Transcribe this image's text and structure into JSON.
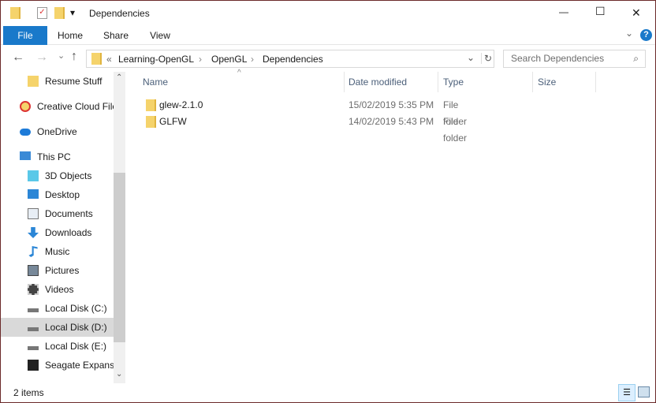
{
  "window": {
    "title": "Dependencies",
    "minimize": "—",
    "maximize": "☐",
    "close": "✕"
  },
  "ribbon": {
    "tabs": [
      "File",
      "Home",
      "Share",
      "View"
    ],
    "expand": "⌄",
    "help": "?"
  },
  "nav": {
    "back": "←",
    "forward": "→",
    "recent": "⌄",
    "up": "↑",
    "breadcrumb": [
      "«",
      "Learning-OpenGL",
      "OpenGL",
      "Dependencies"
    ],
    "sep": "›",
    "dropdown": "⌄",
    "refresh": "↻",
    "search_placeholder": "Search Dependencies"
  },
  "sidebar": {
    "items": [
      {
        "label": "Resume Stuff",
        "icon": "folder-icon"
      },
      {
        "label": "Creative Cloud Files",
        "icon": "creative-cloud-icon"
      },
      {
        "label": "OneDrive",
        "icon": "onedrive-icon"
      },
      {
        "label": "This PC",
        "icon": "pc-icon"
      },
      {
        "label": "3D Objects",
        "icon": "3d-objects-icon"
      },
      {
        "label": "Desktop",
        "icon": "desktop-icon"
      },
      {
        "label": "Documents",
        "icon": "documents-icon"
      },
      {
        "label": "Downloads",
        "icon": "downloads-icon"
      },
      {
        "label": "Music",
        "icon": "music-icon"
      },
      {
        "label": "Pictures",
        "icon": "pictures-icon"
      },
      {
        "label": "Videos",
        "icon": "videos-icon"
      },
      {
        "label": "Local Disk (C:)",
        "icon": "disk-icon"
      },
      {
        "label": "Local Disk (D:)",
        "icon": "disk-icon",
        "selected": true
      },
      {
        "label": "Local Disk (E:)",
        "icon": "disk-icon"
      },
      {
        "label": "Seagate Expansion Drive",
        "icon": "external-drive-icon"
      }
    ]
  },
  "columns": [
    "Name",
    "Date modified",
    "Type",
    "Size"
  ],
  "files": [
    {
      "name": "glew-2.1.0",
      "date": "15/02/2019 5:35 PM",
      "type": "File folder",
      "size": ""
    },
    {
      "name": "GLFW",
      "date": "14/02/2019 5:43 PM",
      "type": "File folder",
      "size": ""
    }
  ],
  "status": {
    "count": "2 items"
  }
}
